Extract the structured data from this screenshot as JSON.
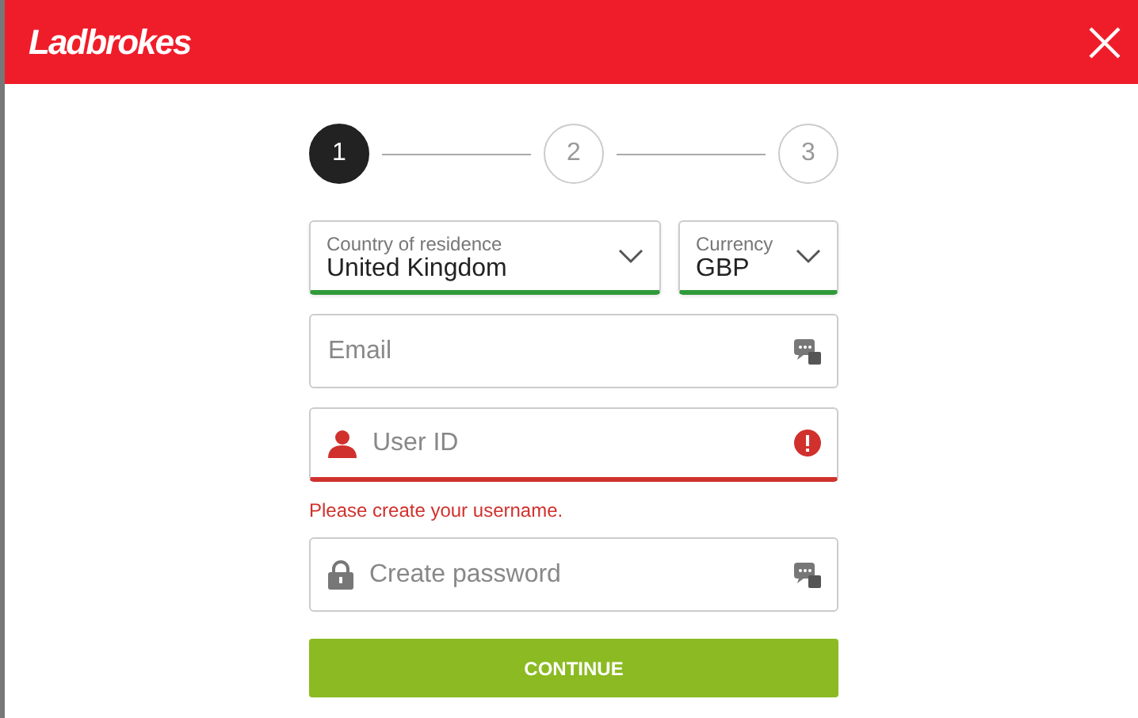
{
  "header": {
    "logo": "Ladbrokes"
  },
  "steps": [
    {
      "label": "1",
      "selected": true
    },
    {
      "label": "2",
      "selected": false
    },
    {
      "label": "3",
      "selected": false
    }
  ],
  "selects": [
    {
      "label": "Country of residence",
      "value": "United Kingdom",
      "valid": true
    },
    {
      "label": "Currency",
      "value": "GBP",
      "valid": true
    }
  ],
  "fields": [
    {
      "kind": "email",
      "placeholder": "Email",
      "invalid": false
    },
    {
      "kind": "username",
      "placeholder": "User ID",
      "invalid": true,
      "error": "Please create your username."
    },
    {
      "kind": "password",
      "placeholder": "Create password",
      "invalid": false
    }
  ],
  "button": {
    "label": "CONTINUE"
  }
}
